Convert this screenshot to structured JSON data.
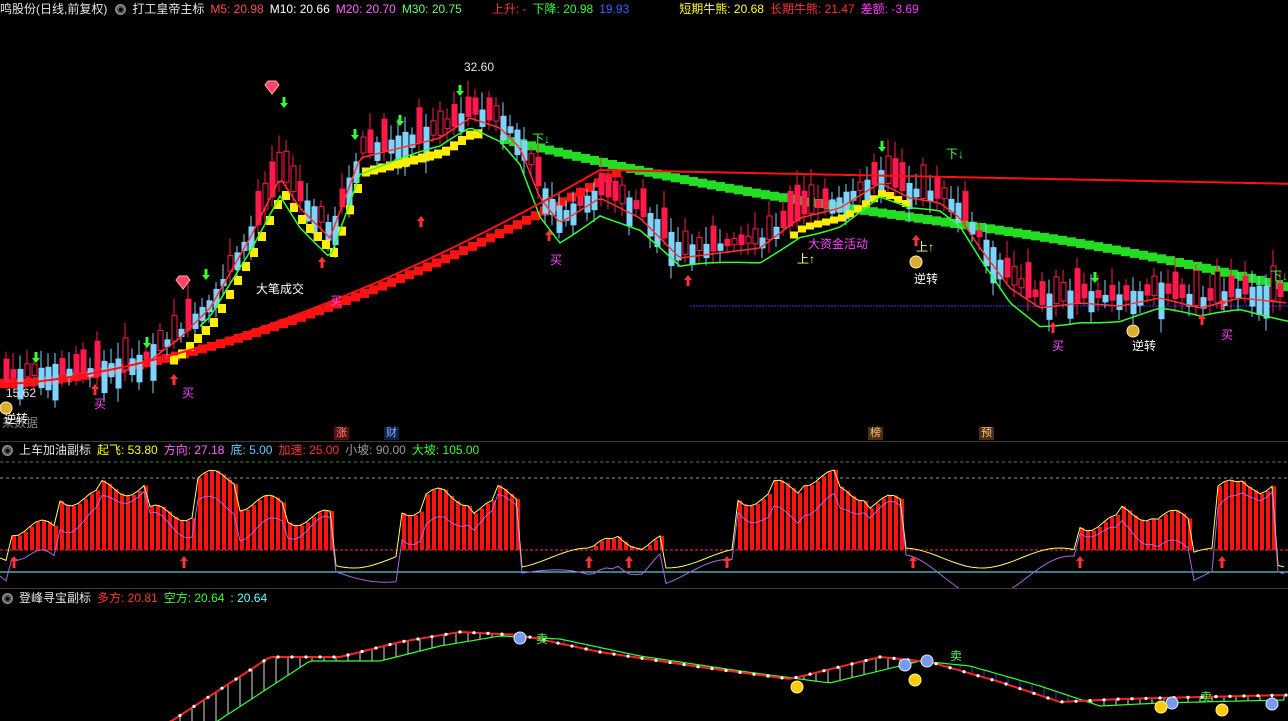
{
  "main": {
    "title_stock": "鸣股份(日线,前复权)",
    "title_indicator": "打工皇帝主标",
    "ma": [
      {
        "label": "M5: 20.98",
        "color": "#ff4d4d"
      },
      {
        "label": "M10: 20.66",
        "color": "#ffffff"
      },
      {
        "label": "M20: 20.70",
        "color": "#ff66ff"
      },
      {
        "label": "M30: 20.75",
        "color": "#66ff66"
      }
    ],
    "up_label": "上升: -",
    "down_label": "下降: 20.98",
    "extra_value": "19.93",
    "short_cow": "短期牛熊: 20.68",
    "long_cow": "长期牛熊: 21.47",
    "diff": "差额: -3.69",
    "high_price": "32.60",
    "low_price": "15.62",
    "no_data": "来数据",
    "events": [
      "涨",
      "财",
      "榜",
      "预"
    ],
    "annotations": {
      "big_trade": "大笔成交",
      "big_fund": "大资金活动",
      "buy": "买",
      "reverse": "逆转",
      "up": "上↑",
      "down": "下↓",
      "reverse_short": "逆转"
    }
  },
  "sub1": {
    "title": "上车加油副标",
    "params": [
      {
        "label": "起飞: 53.80",
        "color": "#ffff00"
      },
      {
        "label": "方向: 27.18",
        "color": "#ff66ff"
      },
      {
        "label": "底: 5.00",
        "color": "#66ccff"
      },
      {
        "label": "加速: 25.00",
        "color": "#ff3333"
      },
      {
        "label": "小坡: 90.00",
        "color": "#9c9c9c"
      },
      {
        "label": "大坡: 105.00",
        "color": "#33ff33"
      }
    ]
  },
  "sub2": {
    "title": "登峰寻宝副标",
    "params": [
      {
        "label": "多方: 20.81",
        "color": "#ff3333"
      },
      {
        "label": "空方: 20.64",
        "color": "#33ff33"
      },
      {
        "label": ": 20.64",
        "color": "#66ffff"
      }
    ],
    "sell": "卖"
  },
  "colors": {
    "up": "#ff1a4b",
    "down": "#7fd3ff",
    "yellow": "#ffee00",
    "green": "#22dd22",
    "red": "#ff1111"
  }
}
